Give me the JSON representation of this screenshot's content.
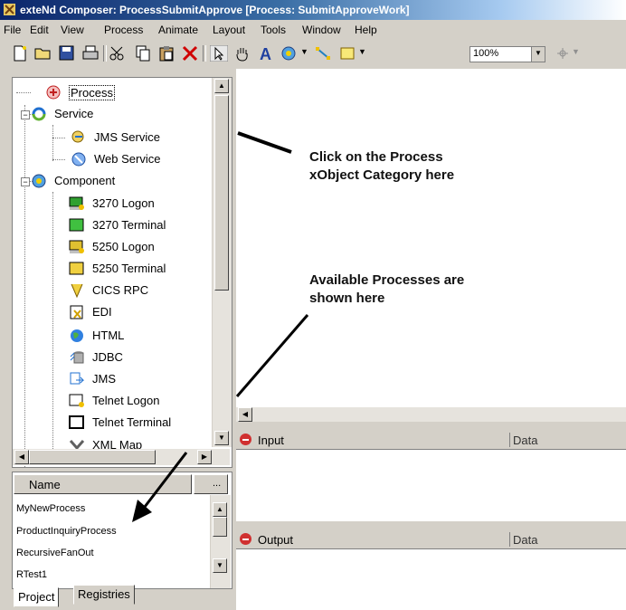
{
  "window": {
    "title": "exteNd Composer: ProcessSubmitApprove [Process: SubmitApproveWork]"
  },
  "menu": [
    "File",
    "Edit",
    "View",
    "Process",
    "Animate",
    "Layout",
    "Tools",
    "Window",
    "Help"
  ],
  "toolbar": {
    "zoom_value": "100%"
  },
  "tree": {
    "process": "Process",
    "service": "Service",
    "jms_service": "JMS Service",
    "web_service": "Web Service",
    "component": "Component",
    "components": [
      "3270 Logon",
      "3270 Terminal",
      "5250 Logon",
      "5250 Terminal",
      "CICS RPC",
      "EDI",
      "HTML",
      "JDBC",
      "JMS",
      "Telnet Logon",
      "Telnet Terminal",
      "XML Map"
    ]
  },
  "list": {
    "column_name": "Name",
    "column_more": "...",
    "rows": [
      "MyNewProcess",
      "ProductInquiryProcess",
      "RecursiveFanOut",
      "RTest1"
    ]
  },
  "tabs": [
    "Project",
    "Registries"
  ],
  "panes": {
    "input": {
      "title": "Input",
      "column": "Data"
    },
    "output": {
      "title": "Output",
      "column": "Data"
    }
  },
  "annotations": {
    "click_line1": "Click on the Process",
    "click_line2": "xObject Category here",
    "avail_line1": "Available Processes are",
    "avail_line2": "shown here"
  },
  "colors": {
    "title_start": "#0a246a",
    "frame": "#d4d0c8",
    "pane_icon": "#d03030"
  }
}
